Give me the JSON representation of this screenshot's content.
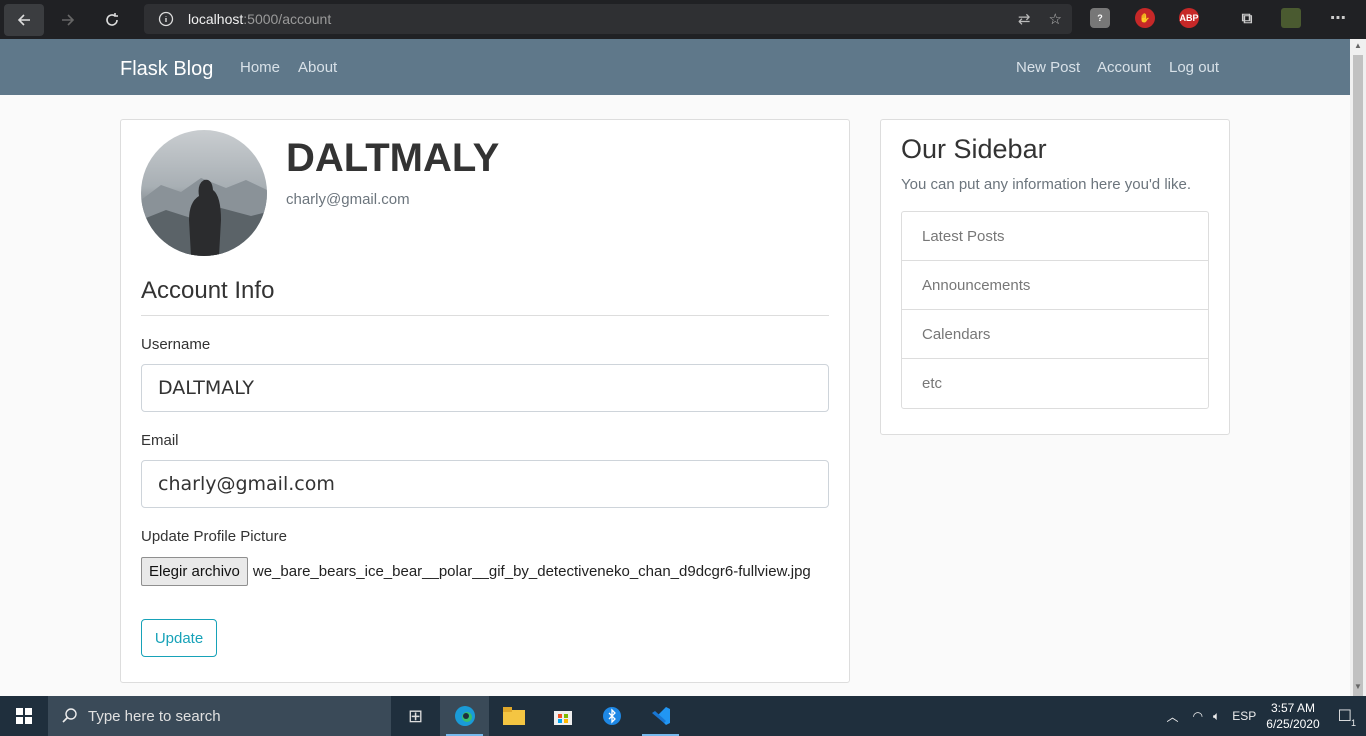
{
  "browser": {
    "url_host": "localhost",
    "url_path": ":5000/account",
    "icons": [
      "back-icon",
      "forward-icon",
      "refresh-icon",
      "info-icon",
      "translate-icon",
      "favorite-star-icon",
      "shield-extension-icon",
      "stop-extension-icon",
      "abp-extension-icon",
      "collections-icon",
      "profile-avatar-icon",
      "more-icon"
    ],
    "abp_label": "ABP"
  },
  "navbar": {
    "brand": "Flask Blog",
    "left_links": [
      "Home",
      "About"
    ],
    "right_links": [
      "New Post",
      "Account",
      "Log out"
    ],
    "background": "#5f788a"
  },
  "profile": {
    "username": "DALTMALY",
    "email": "charly@gmail.com"
  },
  "form": {
    "legend": "Account Info",
    "username_label": "Username",
    "username_value": "DALTMALY",
    "email_label": "Email",
    "email_value": "charly@gmail.com",
    "picture_label": "Update Profile Picture",
    "file_button": "Elegir archivo",
    "file_name": "we_bare_bears_ice_bear__polar__gif_by_detectiveneko_chan_d9dcgr6-fullview.jpg",
    "submit_label": "Update",
    "accent_color": "#17a2b8"
  },
  "sidebar": {
    "title": "Our Sidebar",
    "text": "You can put any information here you'd like.",
    "items": [
      "Latest Posts",
      "Announcements",
      "Calendars",
      "etc"
    ]
  },
  "taskbar": {
    "search_placeholder": "Type here to search",
    "language": "ESP",
    "time": "3:57 AM",
    "date": "6/25/2020",
    "notification_count": "1"
  }
}
